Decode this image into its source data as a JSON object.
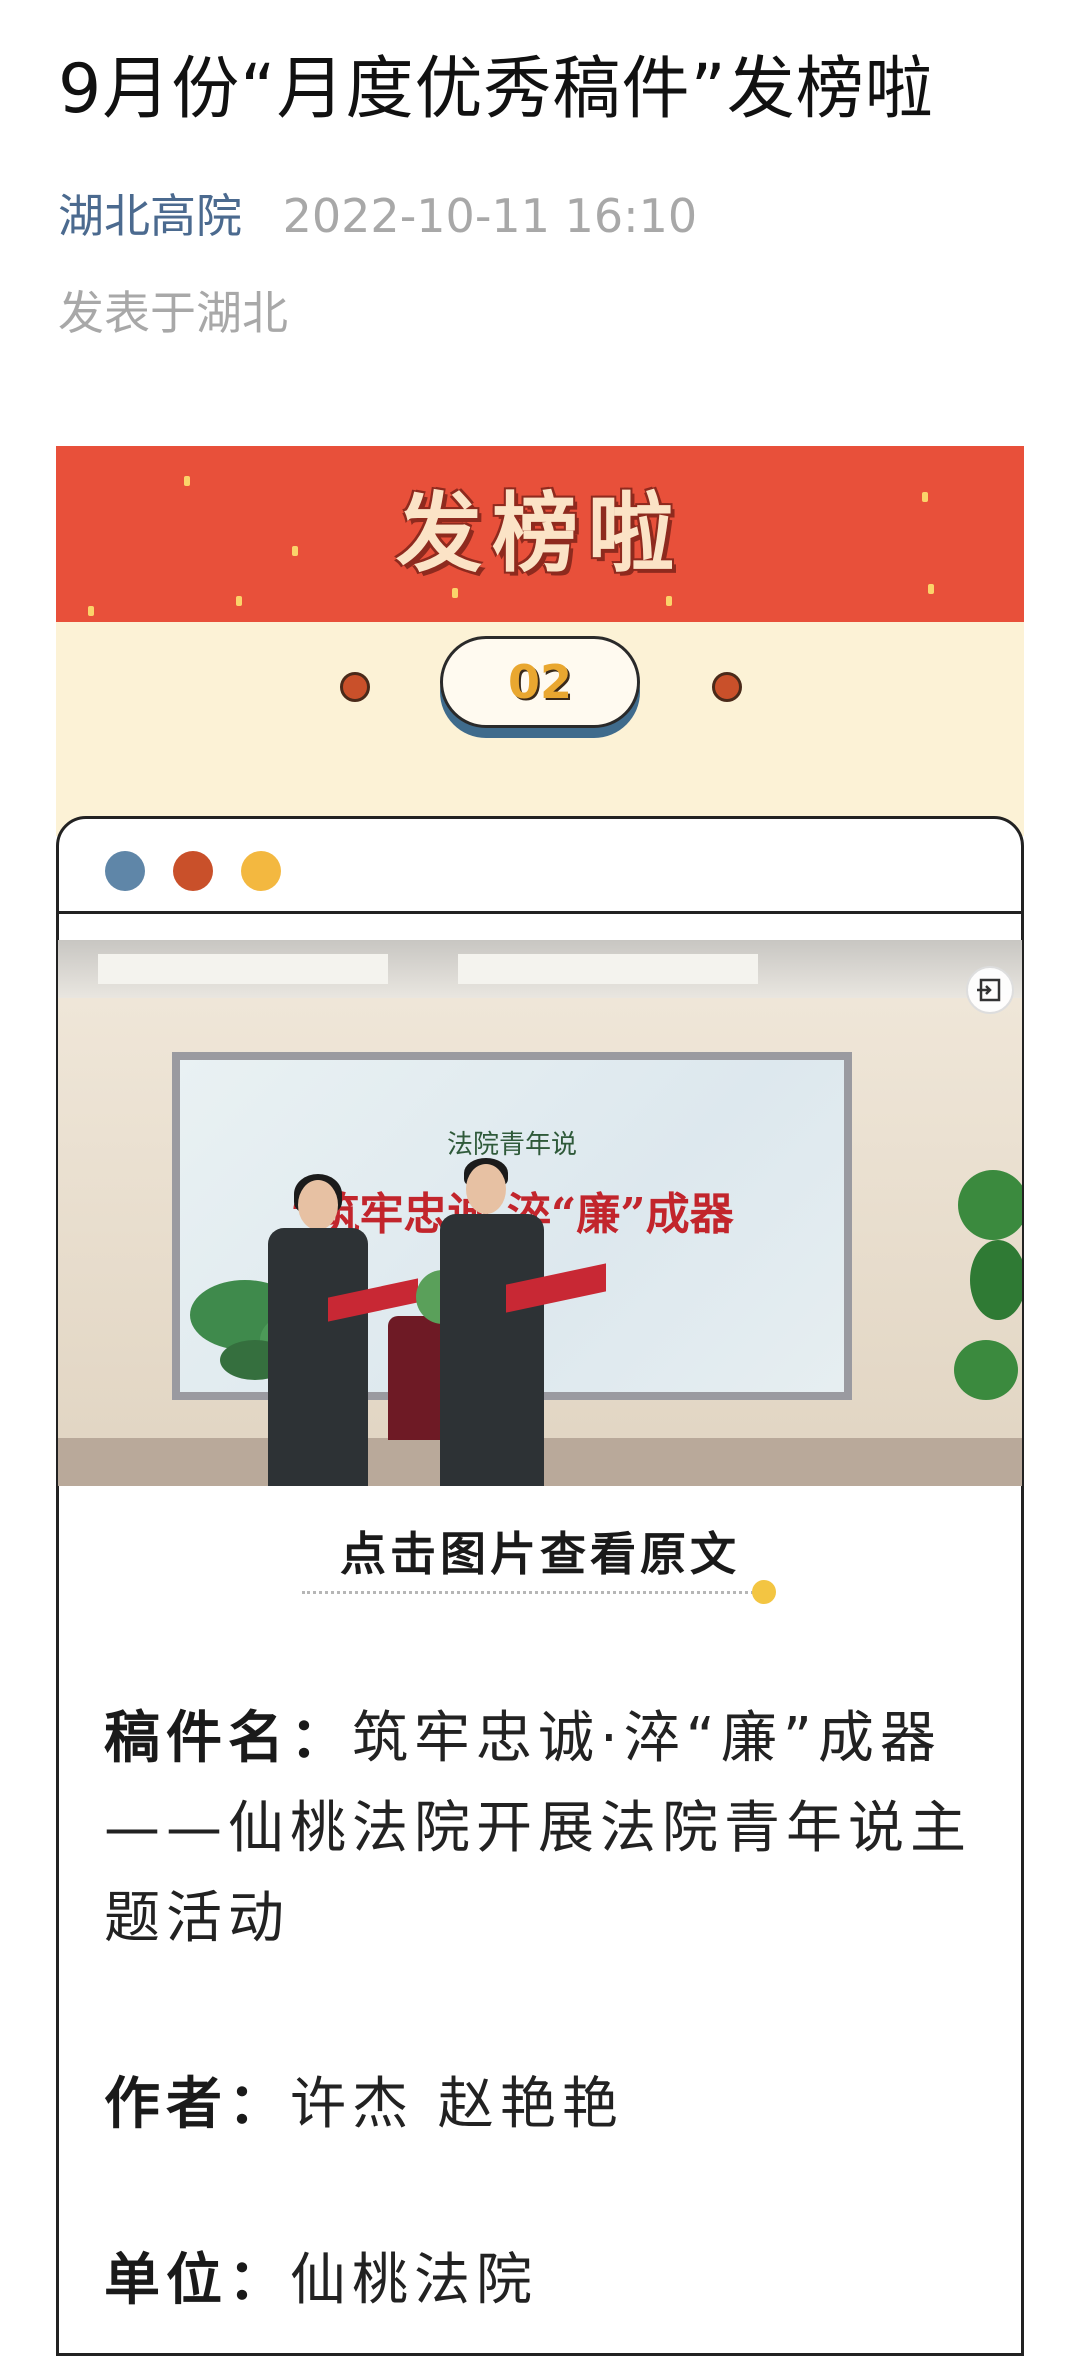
{
  "article": {
    "title": "9月份“月度优秀稿件”发榜啦",
    "author": "湖北高院",
    "time": "2022-10-11 16:10",
    "location": "发表于湖北"
  },
  "card": {
    "banner_title": "发榜啦",
    "number": "02",
    "photo": {
      "screen_subtitle": "法院青年说",
      "screen_title": "“筑牢忠诚 淬“廉”成器"
    },
    "caption": "点击图片查看原文",
    "fields": [
      {
        "label": "稿件名：",
        "value": "筑牢忠诚·淬“廉”成器——仙桃法院开展法院青年说主题活动"
      },
      {
        "label": "作者：",
        "value": "许杰 赵艳艳"
      },
      {
        "label": "单位：",
        "value": "仙桃法院"
      }
    ]
  },
  "colors": {
    "banner_red": "#e8503a",
    "cream": "#fcf2d6",
    "dot_blue": "#5f86a8",
    "dot_orange": "#c9502a",
    "dot_yellow": "#f3b840",
    "author_blue": "#4b6a8f"
  },
  "icons": {
    "exit": "exit-icon"
  }
}
